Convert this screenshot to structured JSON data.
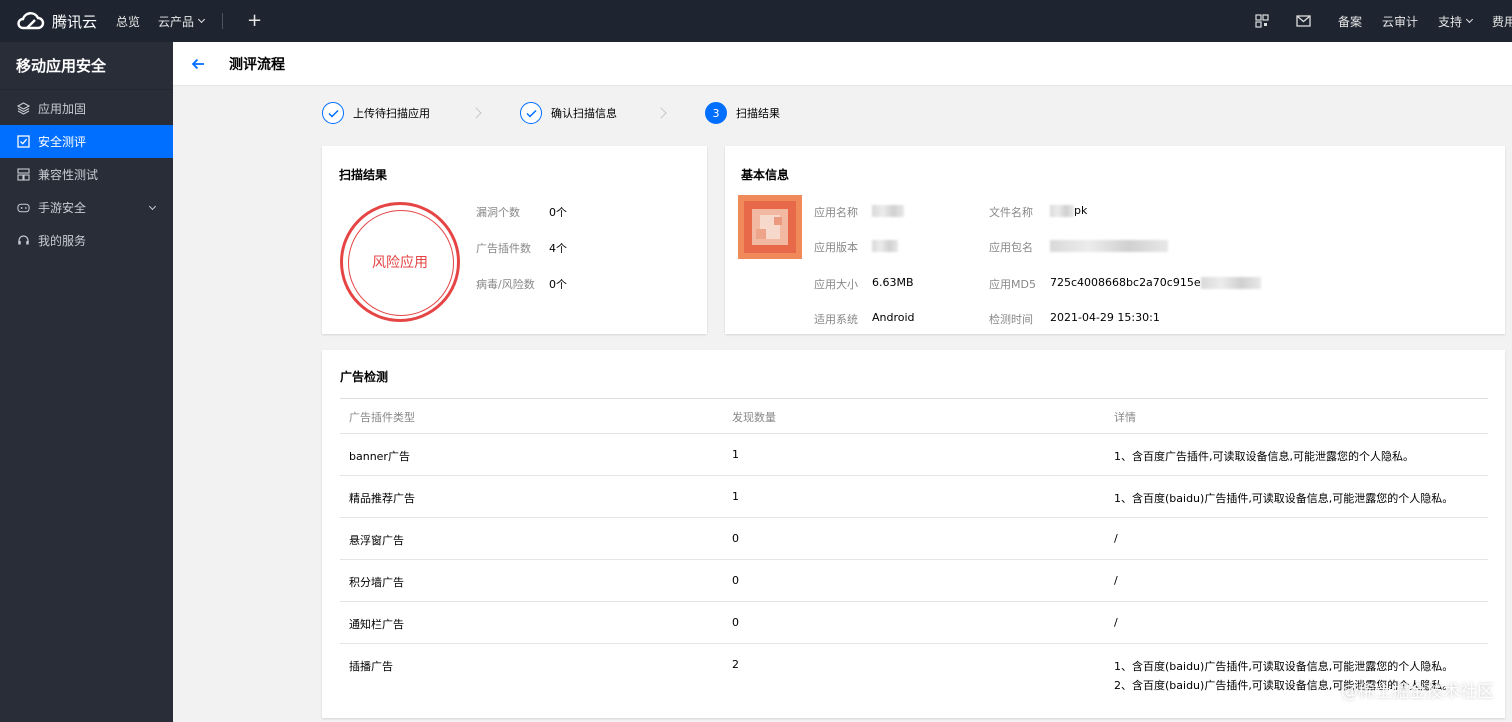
{
  "topbar": {
    "brand": "腾讯云",
    "nav": [
      "总览",
      "云产品"
    ],
    "right": [
      "备案",
      "云审计",
      "支持",
      "费用"
    ]
  },
  "sidebar": {
    "title": "移动应用安全",
    "items": [
      {
        "label": "应用加固",
        "icon": "layers-icon"
      },
      {
        "label": "安全测评",
        "icon": "checkbox-icon"
      },
      {
        "label": "兼容性测试",
        "icon": "grid-icon"
      },
      {
        "label": "手游安全",
        "icon": "gamepad-icon"
      },
      {
        "label": "我的服务",
        "icon": "headset-icon"
      }
    ]
  },
  "page": {
    "title": "测评流程"
  },
  "steps": [
    {
      "label": "上传待扫描应用"
    },
    {
      "label": "确认扫描信息"
    },
    {
      "num": "3",
      "label": "扫描结果"
    }
  ],
  "scan": {
    "title": "扫描结果",
    "verdict": "风险应用",
    "stats": [
      {
        "label": "漏洞个数",
        "value": "0个"
      },
      {
        "label": "广告插件数",
        "value": "4个"
      },
      {
        "label": "病毒/风险数",
        "value": "0个"
      }
    ]
  },
  "info": {
    "title": "基本信息",
    "labels": {
      "name": "应用名称",
      "version": "应用版本",
      "size": "应用大小",
      "system": "适用系统",
      "file": "文件名称",
      "package": "应用包名",
      "md5": "应用MD5",
      "time": "检测时间"
    },
    "values": {
      "size": "6.63MB",
      "system": "Android",
      "file_suffix": "pk",
      "md5": "725c4008668bc2a70c915e",
      "time": "2021-04-29 15:30:1"
    }
  },
  "ads": {
    "title": "广告检测",
    "columns": [
      "广告插件类型",
      "发现数量",
      "详情"
    ],
    "rows": [
      {
        "type": "banner广告",
        "count": "1",
        "details": [
          "1、含百度广告插件,可读取设备信息,可能泄露您的个人隐私。"
        ]
      },
      {
        "type": "精品推荐广告",
        "count": "1",
        "details": [
          "1、含百度(baidu)广告插件,可读取设备信息,可能泄露您的个人隐私。"
        ]
      },
      {
        "type": "悬浮窗广告",
        "count": "0",
        "details": [
          "/"
        ]
      },
      {
        "type": "积分墙广告",
        "count": "0",
        "details": [
          "/"
        ]
      },
      {
        "type": "通知栏广告",
        "count": "0",
        "details": [
          "/"
        ]
      },
      {
        "type": "插播广告",
        "count": "2",
        "details": [
          "1、含百度(baidu)广告插件,可读取设备信息,可能泄露您的个人隐私。",
          "2、含百度(baidu)广告插件,可读取设备信息,可能泄露您的个人隐私。"
        ]
      }
    ]
  },
  "watermark": "@稀土掘金技术社区",
  "colors": {
    "primary": "#006eff",
    "danger": "#e54545",
    "topbar": "#1f2530",
    "sidebar": "#292d38"
  }
}
